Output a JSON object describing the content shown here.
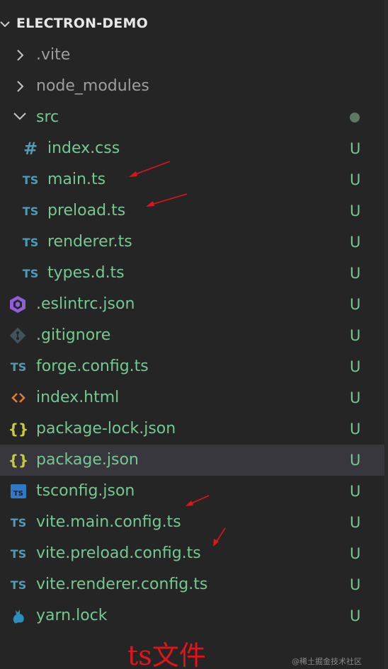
{
  "explorer": {
    "title": "ELECTRON-DEMO",
    "items": [
      {
        "label": ".vite",
        "status": "",
        "kind": "folder-collapsed",
        "icon": "chevron-right-icon",
        "text_color": "#9e9e9e"
      },
      {
        "label": "node_modules",
        "status": "",
        "kind": "folder-collapsed",
        "icon": "chevron-right-icon",
        "text_color": "#9e9e9e"
      },
      {
        "label": "src",
        "status": "",
        "kind": "folder-expanded",
        "icon": "chevron-down-icon",
        "text_color": "#73c991",
        "modified_dot": true
      },
      {
        "label": "index.css",
        "status": "U",
        "kind": "file",
        "icon_text": "#",
        "icon": "css-file-icon"
      },
      {
        "label": "main.ts",
        "status": "U",
        "kind": "file",
        "icon_text": "TS",
        "icon": "typescript-file-icon"
      },
      {
        "label": "preload.ts",
        "status": "U",
        "kind": "file",
        "icon_text": "TS",
        "icon": "typescript-file-icon"
      },
      {
        "label": "renderer.ts",
        "status": "U",
        "kind": "file",
        "icon_text": "TS",
        "icon": "typescript-file-icon"
      },
      {
        "label": "types.d.ts",
        "status": "U",
        "kind": "file",
        "icon_text": "TS",
        "icon": "typescript-file-icon"
      },
      {
        "label": ".eslintrc.json",
        "status": "U",
        "kind": "file",
        "icon": "eslint-icon"
      },
      {
        "label": ".gitignore",
        "status": "U",
        "kind": "file",
        "icon": "git-icon"
      },
      {
        "label": "forge.config.ts",
        "status": "U",
        "kind": "file",
        "icon_text": "TS",
        "icon": "typescript-file-icon"
      },
      {
        "label": "index.html",
        "status": "U",
        "kind": "file",
        "icon_text": "<>",
        "icon": "html-file-icon"
      },
      {
        "label": "package-lock.json",
        "status": "U",
        "kind": "file",
        "icon_text": "{}",
        "icon": "json-file-icon"
      },
      {
        "label": "package.json",
        "status": "U",
        "kind": "file",
        "icon_text": "{}",
        "icon": "json-file-icon",
        "selected": true
      },
      {
        "label": "tsconfig.json",
        "status": "U",
        "kind": "file",
        "icon_text": "TS",
        "icon": "tsconfig-icon"
      },
      {
        "label": "vite.main.config.ts",
        "status": "U",
        "kind": "file",
        "icon_text": "TS",
        "icon": "typescript-file-icon"
      },
      {
        "label": "vite.preload.config.ts",
        "status": "U",
        "kind": "file",
        "icon_text": "TS",
        "icon": "typescript-file-icon"
      },
      {
        "label": "vite.renderer.config.ts",
        "status": "U",
        "kind": "file",
        "icon_text": "TS",
        "icon": "typescript-file-icon"
      },
      {
        "label": "yarn.lock",
        "status": "U",
        "kind": "file",
        "icon": "yarn-icon"
      }
    ]
  },
  "annotation": {
    "text": "ts文件",
    "color": "#e1141a"
  },
  "watermark": "@稀土掘金技术社区",
  "colors": {
    "background": "#252526",
    "selected_row": "#37373d",
    "untracked_green": "#73c991",
    "ts_blue": "#519aba",
    "json_yellow": "#cbcb41"
  }
}
